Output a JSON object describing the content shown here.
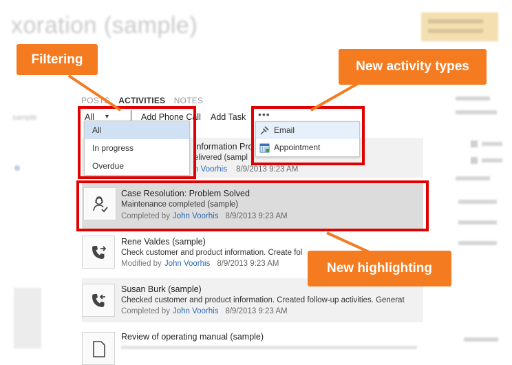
{
  "background": {
    "title": "xoration (sample)",
    "left_label": "sample"
  },
  "tabs": [
    {
      "label": "POSTS",
      "active": false
    },
    {
      "label": "ACTIVITIES",
      "active": true
    },
    {
      "label": "NOTES",
      "active": false
    }
  ],
  "toolbar": {
    "filter_value": "All",
    "add_phone_call": "Add Phone Call",
    "add_task": "Add Task",
    "more": "•••"
  },
  "filter_menu": {
    "items": [
      {
        "label": "All",
        "selected": true
      },
      {
        "label": "In progress",
        "selected": false
      },
      {
        "label": "Overdue",
        "selected": false
      }
    ]
  },
  "types_menu": {
    "items": [
      {
        "label": "Email",
        "icon": "pin-icon",
        "selected": true
      },
      {
        "label": "Appointment",
        "icon": "calendar-icon",
        "selected": false
      }
    ]
  },
  "activities": [
    {
      "title": "Information Pro",
      "subtitle": "elivered (sampl",
      "status": "",
      "user": "n Voorhis",
      "time": "8/9/2013 9:23 AM"
    },
    {
      "title": "Case Resolution: Problem Solved",
      "subtitle": "Maintenance completed (sample)",
      "status": "Completed by",
      "user": "John Voorhis",
      "time": "8/9/2013 9:23 AM",
      "icon": "case-resolution-icon"
    },
    {
      "title": "Rene Valdes (sample)",
      "subtitle": "Check customer and product information. Create fol",
      "status": "Modified by",
      "user": "John Voorhis",
      "time": "8/9/2013 9:23 AM",
      "icon": "phone-outgoing-icon"
    },
    {
      "title": "Susan Burk (sample)",
      "subtitle": "Checked customer and product information. Created follow-up activities. Generat",
      "status": "Completed by",
      "user": "John Voorhis",
      "time": "8/9/2013 9:23 AM",
      "icon": "phone-incoming-icon"
    },
    {
      "title": "Review of operating manual (sample)",
      "subtitle": "",
      "status": "",
      "user": "",
      "time": "",
      "icon": "document-icon"
    }
  ],
  "callouts": {
    "filtering": "Filtering",
    "new_activity_types": "New activity types",
    "new_highlighting": "New highlighting"
  },
  "colors": {
    "callout": "#f47b20",
    "frame": "#e00000",
    "link": "#2a67b5",
    "selected_filter": "#cfe1f3",
    "highlight_row": "#dcdcdc"
  }
}
